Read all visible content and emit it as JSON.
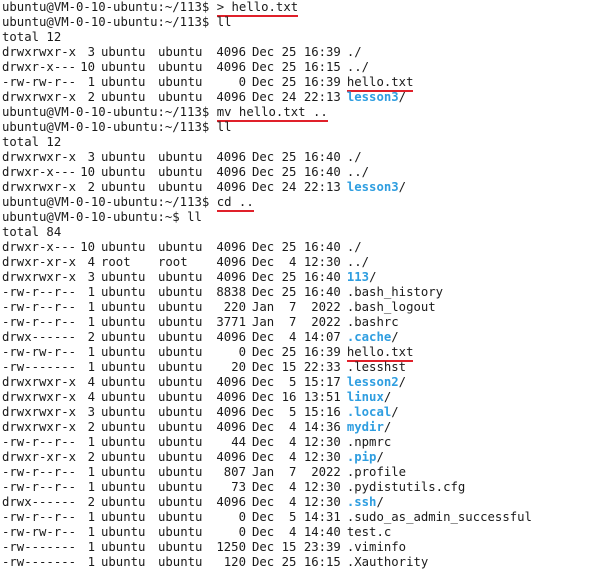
{
  "terminal": {
    "annotation_color": "#e0202a",
    "dir_color": "#2f9ee0",
    "prompt_113": "ubuntu@VM-0-10-ubuntu:~/113$",
    "prompt_home": "ubuntu@VM-0-10-ubuntu:~$",
    "commands": {
      "c1": "> hello.txt",
      "c2": "ll",
      "c3": "mv hello.txt ..",
      "c4": "ll",
      "c5": "cd ..",
      "c6": "ll"
    },
    "totals": {
      "t1": "total 12",
      "t2": "total 12",
      "t3": "total 84"
    },
    "listing1": [
      {
        "perm": "drwxrwxr-x",
        "links": "3",
        "owner": "ubuntu",
        "group": "ubuntu",
        "size": "4096",
        "date": "Dec 25 16:39",
        "name": "./",
        "dir": false
      },
      {
        "perm": "drwxr-x---",
        "links": "10",
        "owner": "ubuntu",
        "group": "ubuntu",
        "size": "4096",
        "date": "Dec 25 16:15",
        "name": "../",
        "dir": false
      },
      {
        "perm": "-rw-rw-r--",
        "links": "1",
        "owner": "ubuntu",
        "group": "ubuntu",
        "size": "0",
        "date": "Dec 25 16:39",
        "name": "hello.txt",
        "dir": false
      },
      {
        "perm": "drwxrwxr-x",
        "links": "2",
        "owner": "ubuntu",
        "group": "ubuntu",
        "size": "4096",
        "date": "Dec 24 22:13",
        "name": "lesson3",
        "slash": "/",
        "dir": true
      }
    ],
    "listing2": [
      {
        "perm": "drwxrwxr-x",
        "links": "3",
        "owner": "ubuntu",
        "group": "ubuntu",
        "size": "4096",
        "date": "Dec 25 16:40",
        "name": "./",
        "dir": false
      },
      {
        "perm": "drwxr-x---",
        "links": "10",
        "owner": "ubuntu",
        "group": "ubuntu",
        "size": "4096",
        "date": "Dec 25 16:40",
        "name": "../",
        "dir": false
      },
      {
        "perm": "drwxrwxr-x",
        "links": "2",
        "owner": "ubuntu",
        "group": "ubuntu",
        "size": "4096",
        "date": "Dec 24 22:13",
        "name": "lesson3",
        "slash": "/",
        "dir": true
      }
    ],
    "listing3": [
      {
        "perm": "drwxr-x---",
        "links": "10",
        "owner": "ubuntu",
        "group": "ubuntu",
        "size": "4096",
        "date": "Dec 25 16:40",
        "name": "./",
        "dir": false
      },
      {
        "perm": "drwxr-xr-x",
        "links": "4",
        "owner": "root",
        "group": "root",
        "size": "4096",
        "date": "Dec  4 12:30",
        "name": "../",
        "dir": false
      },
      {
        "perm": "drwxrwxr-x",
        "links": "3",
        "owner": "ubuntu",
        "group": "ubuntu",
        "size": "4096",
        "date": "Dec 25 16:40",
        "name": "113",
        "slash": "/",
        "dir": true
      },
      {
        "perm": "-rw-r--r--",
        "links": "1",
        "owner": "ubuntu",
        "group": "ubuntu",
        "size": "8838",
        "date": "Dec 25 16:40",
        "name": ".bash_history",
        "dir": false
      },
      {
        "perm": "-rw-r--r--",
        "links": "1",
        "owner": "ubuntu",
        "group": "ubuntu",
        "size": "220",
        "date": "Jan  7  2022",
        "name": ".bash_logout",
        "dir": false
      },
      {
        "perm": "-rw-r--r--",
        "links": "1",
        "owner": "ubuntu",
        "group": "ubuntu",
        "size": "3771",
        "date": "Jan  7  2022",
        "name": ".bashrc",
        "dir": false
      },
      {
        "perm": "drwx------",
        "links": "2",
        "owner": "ubuntu",
        "group": "ubuntu",
        "size": "4096",
        "date": "Dec  4 14:07",
        "name": ".cache",
        "slash": "/",
        "dir": true
      },
      {
        "perm": "-rw-rw-r--",
        "links": "1",
        "owner": "ubuntu",
        "group": "ubuntu",
        "size": "0",
        "date": "Dec 25 16:39",
        "name": "hello.txt",
        "dir": false
      },
      {
        "perm": "-rw-------",
        "links": "1",
        "owner": "ubuntu",
        "group": "ubuntu",
        "size": "20",
        "date": "Dec 15 22:33",
        "name": ".lesshst",
        "dir": false
      },
      {
        "perm": "drwxrwxr-x",
        "links": "4",
        "owner": "ubuntu",
        "group": "ubuntu",
        "size": "4096",
        "date": "Dec  5 15:17",
        "name": "lesson2",
        "slash": "/",
        "dir": true
      },
      {
        "perm": "drwxrwxr-x",
        "links": "4",
        "owner": "ubuntu",
        "group": "ubuntu",
        "size": "4096",
        "date": "Dec 16 13:51",
        "name": "linux",
        "slash": "/",
        "dir": true
      },
      {
        "perm": "drwxrwxr-x",
        "links": "3",
        "owner": "ubuntu",
        "group": "ubuntu",
        "size": "4096",
        "date": "Dec  5 15:16",
        "name": ".local",
        "slash": "/",
        "dir": true
      },
      {
        "perm": "drwxrwxr-x",
        "links": "2",
        "owner": "ubuntu",
        "group": "ubuntu",
        "size": "4096",
        "date": "Dec  4 14:36",
        "name": "mydir",
        "slash": "/",
        "dir": true
      },
      {
        "perm": "-rw-r--r--",
        "links": "1",
        "owner": "ubuntu",
        "group": "ubuntu",
        "size": "44",
        "date": "Dec  4 12:30",
        "name": ".npmrc",
        "dir": false
      },
      {
        "perm": "drwxr-xr-x",
        "links": "2",
        "owner": "ubuntu",
        "group": "ubuntu",
        "size": "4096",
        "date": "Dec  4 12:30",
        "name": ".pip",
        "slash": "/",
        "dir": true
      },
      {
        "perm": "-rw-r--r--",
        "links": "1",
        "owner": "ubuntu",
        "group": "ubuntu",
        "size": "807",
        "date": "Jan  7  2022",
        "name": ".profile",
        "dir": false
      },
      {
        "perm": "-rw-r--r--",
        "links": "1",
        "owner": "ubuntu",
        "group": "ubuntu",
        "size": "73",
        "date": "Dec  4 12:30",
        "name": ".pydistutils.cfg",
        "dir": false
      },
      {
        "perm": "drwx------",
        "links": "2",
        "owner": "ubuntu",
        "group": "ubuntu",
        "size": "4096",
        "date": "Dec  4 12:30",
        "name": ".ssh",
        "slash": "/",
        "dir": true
      },
      {
        "perm": "-rw-r--r--",
        "links": "1",
        "owner": "ubuntu",
        "group": "ubuntu",
        "size": "0",
        "date": "Dec  5 14:31",
        "name": ".sudo_as_admin_successful",
        "dir": false
      },
      {
        "perm": "-rw-rw-r--",
        "links": "1",
        "owner": "ubuntu",
        "group": "ubuntu",
        "size": "0",
        "date": "Dec  4 14:40",
        "name": "test.c",
        "dir": false
      },
      {
        "perm": "-rw-------",
        "links": "1",
        "owner": "ubuntu",
        "group": "ubuntu",
        "size": "1250",
        "date": "Dec 15 23:39",
        "name": ".viminfo",
        "dir": false
      },
      {
        "perm": "-rw-------",
        "links": "1",
        "owner": "ubuntu",
        "group": "ubuntu",
        "size": "120",
        "date": "Dec 25 16:15",
        "name": ".Xauthority",
        "dir": false
      }
    ]
  }
}
